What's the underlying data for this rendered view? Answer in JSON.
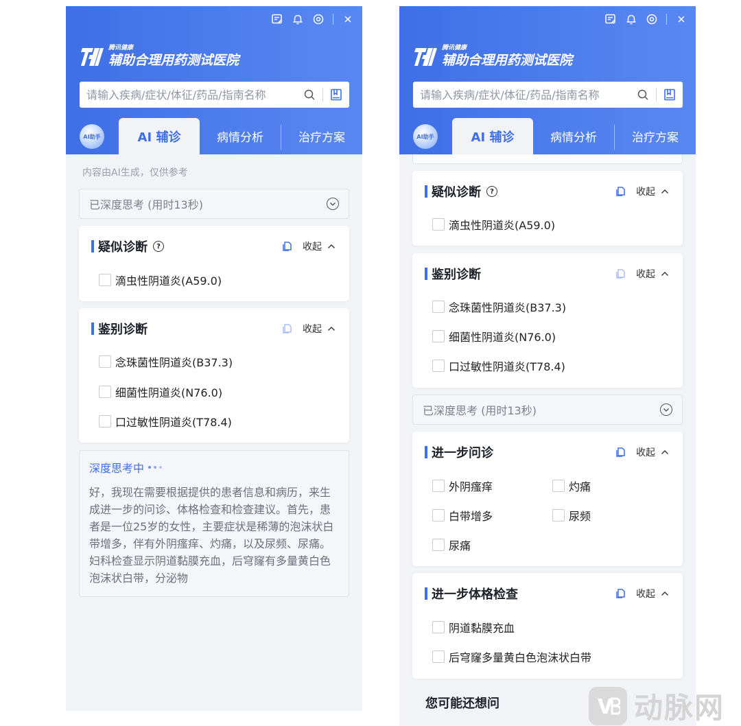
{
  "app": {
    "brand_small": "腾讯健康",
    "brand_title": "辅助合理用药测试医院"
  },
  "search": {
    "placeholder": "请输入疾病/症状/体征/药品/指南名称"
  },
  "tabs": {
    "avatar_label": "AI助手",
    "active": "AI 辅诊",
    "tab2": "病情分析",
    "tab3": "治疗方案"
  },
  "disclaimer": "内容由AI生成，仅供参考",
  "thinking": {
    "done_label": "已深度思考 (用时13秒)",
    "in_progress_label": "深度思考中"
  },
  "collapse_label": "收起",
  "suspected": {
    "title": "疑似诊断",
    "items": [
      "滴虫性阴道炎(A59.0)"
    ]
  },
  "differential": {
    "title": "鉴别诊断",
    "items": [
      "念珠菌性阴道炎(B37.3)",
      "细菌性阴道炎(N76.0)",
      "口过敏性阴道炎(T78.4)"
    ]
  },
  "deep_text": "好，我现在需要根据提供的患者信息和病历，来生成进一步的问诊、体格检查和检查建议。首先，患者是一位25岁的女性，主要症状是稀薄的泡沫状白带增多，伴有外阴瘙痒、灼痛，以及尿频、尿痛。妇科检查显示阴道黏膜充血，后穹窿有多量黄白色泡沫状白带，分泌物",
  "further_inquiry": {
    "title": "进一步问诊",
    "items": [
      "外阴瘙痒",
      "灼痛",
      "白带增多",
      "尿频",
      "尿痛"
    ]
  },
  "further_exam": {
    "title": "进一步体格检查",
    "items": [
      "阴道黏膜充血",
      "后穹窿多量黄白色泡沫状白带"
    ]
  },
  "maybe_ask": "您可能还想问",
  "watermark": "动脉网",
  "colors": {
    "primary": "#3f6fe6",
    "header_end": "#5a88f2",
    "panel_bg": "#f1f3f7"
  }
}
